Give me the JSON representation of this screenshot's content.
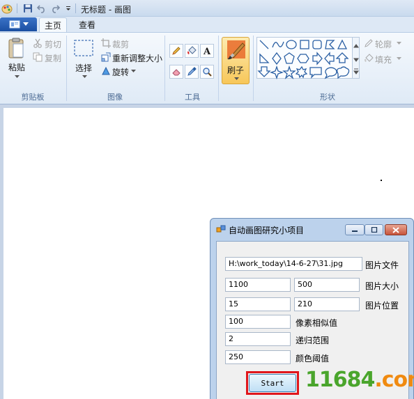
{
  "window": {
    "title": "无标题 - 画图"
  },
  "tabs": {
    "home": "主页",
    "view": "查看"
  },
  "ribbon": {
    "clipboard": {
      "label": "剪贴板",
      "paste": "粘贴",
      "cut": "剪切",
      "copy": "复制"
    },
    "image": {
      "label": "图像",
      "select": "选择",
      "crop": "裁剪",
      "resize": "重新调整大小",
      "rotate": "旋转"
    },
    "tools": {
      "label": "工具"
    },
    "brushes": {
      "label": "刷子"
    },
    "shapes": {
      "label": "形状",
      "outline": "轮廓",
      "fill": "填充"
    }
  },
  "dialog": {
    "title": "自动画图研究小项目",
    "image_file": {
      "value": "H:\\work_today\\14-6-27\\31.jpg",
      "label": "图片文件"
    },
    "image_size": {
      "width": "1100",
      "height": "500",
      "label": "图片大小"
    },
    "image_position": {
      "x": "15",
      "y": "210",
      "label": "图片位置"
    },
    "pixel_similarity": {
      "value": "100",
      "label": "像素相似值"
    },
    "recursion_range": {
      "value": "2",
      "label": "递归范围"
    },
    "color_threshold": {
      "value": "250",
      "label": "颜色阈值"
    },
    "start_label": "Start"
  },
  "watermark": {
    "green": "11684",
    "orange": ".com"
  },
  "colors": {
    "accent": "#1b4fa2",
    "highlight_box": "#e0161b",
    "ribbon_bg": "#dfeaf6",
    "canvas_bg": "#c7d4e6"
  }
}
